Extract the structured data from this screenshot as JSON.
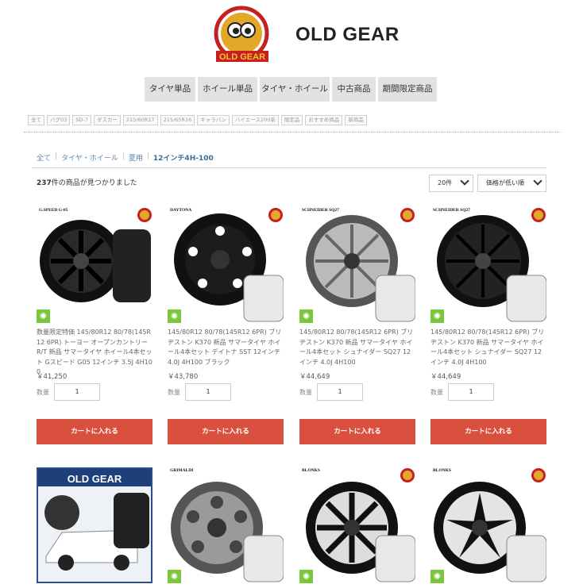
{
  "site": {
    "title": "OLD GEAR",
    "logo_text": "OLD GEAR"
  },
  "nav": [
    {
      "label": "タイヤ単品"
    },
    {
      "label": "ホイール単品"
    },
    {
      "label": "タイヤ・ホイール"
    },
    {
      "label": "中古商品"
    },
    {
      "label": "期間限定商品"
    }
  ],
  "tags": [
    "全て",
    "バグ03",
    "SD-7",
    "ダスカー",
    "215/60R17",
    "215/65R16",
    "キャラバン",
    "ハイエース200系",
    "限定品",
    "おすすめ商品",
    "新商品"
  ],
  "breadcrumb": {
    "items": [
      "全て",
      "タイヤ・ホイール",
      "夏用"
    ],
    "current": "12インチ4H-100"
  },
  "results": {
    "count": "237",
    "suffix": "件の商品が見つかりました"
  },
  "sort": {
    "per_page": "20件",
    "order": "価格が低い順"
  },
  "products": [
    {
      "title": "数量限定特価 145/80R12 80/78(145R12 6PR) トーヨー オープンカントリー R/T 新品 サマータイヤ ホイール4本セット Gスピード G05 12インチ 3.5J 4H100",
      "price": "￥41,250",
      "qty_label": "数量",
      "qty": "1",
      "cart": "カートに入れる",
      "maker": "G.SPEED G-05"
    },
    {
      "title": "145/80R12 80/78(145R12 6PR) ブリヂストン K370 新品 サマータイヤ ホイール4本セット デイトナ SST 12インチ 4.0J 4H100 ブラック",
      "price": "￥43,780",
      "qty_label": "数量",
      "qty": "1",
      "cart": "カートに入れる",
      "maker": "DAYTONA"
    },
    {
      "title": "145/80R12 80/78(145R12 6PR) ブリヂストン K370 新品 サマータイヤ ホイール4本セット シュナイダー SQ27 12インチ 4.0J 4H100",
      "price": "￥44,649",
      "qty_label": "数量",
      "qty": "1",
      "cart": "カートに入れる",
      "maker": "SCHNEIDER SQ27"
    },
    {
      "title": "145/80R12 80/78(145R12 6PR) ブリヂストン K370 新品 サマータイヤ ホイール4本セット シュナイダー SQ27 12インチ 4.0J 4H100",
      "price": "￥44,649",
      "qty_label": "数量",
      "qty": "1",
      "cart": "カートに入れる",
      "maker": "SCHNEIDER SQ27"
    },
    {
      "maker": "OLD GEAR"
    },
    {
      "maker": "GRIMALDI"
    },
    {
      "maker": "BLONKS"
    },
    {
      "maker": "BLONKS"
    }
  ],
  "icons": {
    "badge": "leaf-icon",
    "brand": "brand-logo-icon",
    "chevron": "chevron-down-icon"
  },
  "colors": {
    "cart": "#d9503f",
    "link": "#5a86b2",
    "badge": "#7cc63b"
  }
}
